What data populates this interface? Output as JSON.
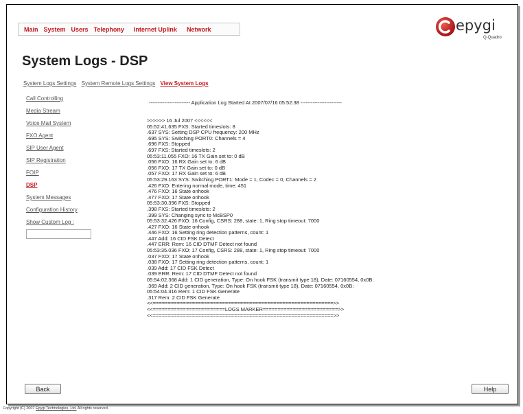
{
  "nav": {
    "items": [
      "Main",
      "System",
      "Users",
      "Telephony",
      "Internet Uplink",
      "Network"
    ]
  },
  "logo": {
    "word": "epygi",
    "sub": "Q-Quadro"
  },
  "page": {
    "title": "System Logs - DSP"
  },
  "tabs": [
    {
      "label": "System Logs Settings",
      "active": false
    },
    {
      "label": "System Remote Logs Settings",
      "active": false
    },
    {
      "label": "View System Logs",
      "active": true
    }
  ],
  "sidebar": {
    "items": [
      {
        "label": "Call Controlling",
        "active": false
      },
      {
        "label": "Media Stream",
        "active": false
      },
      {
        "label": "Voice Mail System",
        "active": false
      },
      {
        "label": "FXO Agent",
        "active": false
      },
      {
        "label": "SIP User Agent",
        "active": false
      },
      {
        "label": "SIP Registration",
        "active": false
      },
      {
        "label": "FOIP",
        "active": false
      },
      {
        "label": "DSP",
        "active": true
      },
      {
        "label": "System Messages",
        "active": false
      },
      {
        "label": "Configuration History",
        "active": false
      },
      {
        "label": "Show Custom Log :",
        "active": false
      }
    ],
    "custom_log_value": ""
  },
  "log": {
    "header": "------------------------ Application Log Started At 2007/07/16 05:52:38 ------------------------",
    "lines": [
      ">>>>>> 16 Jul 2007 <<<<<<",
      "05:52:41.635 FXS: Started timeslots: 8",
      ".637 SYS: Setting DSP CPU frequency: 200 MHz",
      ".695 SYS: Switching PORT0: Channels = 4",
      ".696 FXS: Stopped",
      ".697 FXS: Started timeslots: 2",
      "05:53:11.055 FXO: 16 TX Gain set to: 0 dB",
      ".056 FXO: 16 RX Gain set to: 6 dB",
      ".056 FXO: 17 TX Gain set to: 0 dB",
      ".057 FXO: 17 RX Gain set to: 6 dB",
      "05:53:29.163 SYS: Switching PORT1: Mode = 1, Codec = 0, Channels = 2",
      ".426 FXO: Entering normal mode, time: 451",
      ".476 FXO: 16 State onhook",
      ".477 FXO: 17 State onhook",
      "05:53:30.396 FXS: Stopped",
      ".398 FXS: Started timeslots: 2",
      ".399 SYS: Changing sync to McBSP0",
      "05:53:32.426 FXO: 16 Config, CSRS: 288, state: 1, Ring stop timeout: 7000",
      ".427 FXO: 16 State onhook",
      ".446 FXO: 16 Setting ring detection patterns, count: 1",
      ".447 Add: 16 CID FSK Detect",
      ".447 ERR: Rem: 16 CID DTMF Detect not found",
      "05:53:35.036 FXO: 17 Config, CSRS: 288, state: 1, Ring stop timeout: 7000",
      ".037 FXO: 17 State onhook",
      ".038 FXO: 17 Setting ring detection patterns, count: 1",
      ".039 Add: 17 CID FSK Detect",
      ".039 ERR: Rem: 17 CID DTMF Detect not found",
      "05:54:02.368 Add: 1 CID generation, Type: On hook FSK (transmit type 18), Date: 07160554, 0x0B:",
      ".369 Add: 2 CID generation, Type: On hook FSK (transmit type 18), Date: 07160554, 0x0B:",
      "05:54:04.316 Rem: 1 CID FSK Generate",
      ".317 Rem: 2 CID FSK Generate",
      "<<============================================================>>",
      "<<========================LOGS MARKER=========================>>",
      "<<============================================================>>"
    ]
  },
  "buttons": {
    "back": "Back",
    "help": "Help"
  },
  "footer": {
    "prefix": "Copyright (C) 2007 ",
    "link": "Epygi Technologies, Ltd.",
    "suffix": " All rights reserved."
  }
}
